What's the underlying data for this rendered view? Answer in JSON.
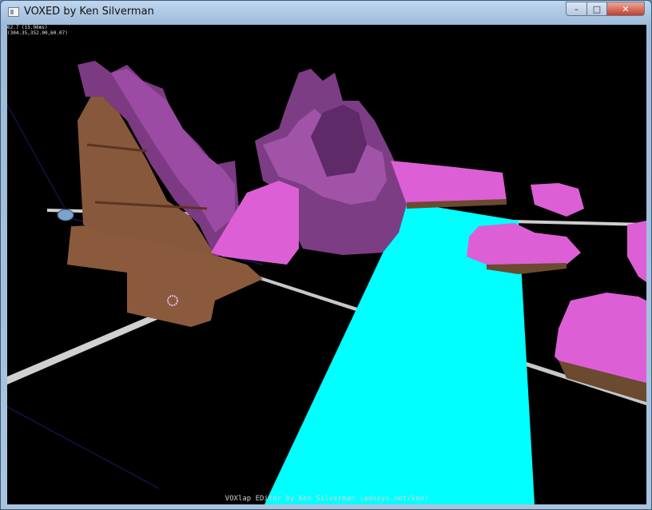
{
  "window": {
    "title": "VOXED by Ken Silverman",
    "minimize_glyph": "–",
    "maximize_glyph": "□",
    "close_glyph": "✕"
  },
  "hud": {
    "fps_line": "62.7 (15.96ms)",
    "position_line": "(304.35,352.00,60.07)"
  },
  "status_bar": {
    "text": "VOXlap EDitor by Ken Silverman (advsys.net/ken)"
  },
  "colors": {
    "background": "#000000",
    "terrain_top": "#d95bd3",
    "terrain_side": "#8a3c8a",
    "dirt": "#8b5a3c",
    "water": "#00ffff",
    "grid_line": "#d8d8d8"
  }
}
